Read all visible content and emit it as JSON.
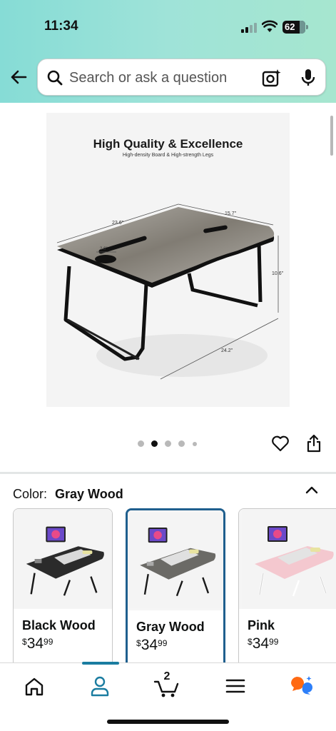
{
  "status_bar": {
    "time": "11:34",
    "battery": "62"
  },
  "search": {
    "placeholder": "Search or ask a question"
  },
  "product_image": {
    "title": "High Quality & Excellence",
    "subtitle": "High-density Board & High-strength Legs",
    "dimensions": [
      "23.6\"",
      "15.7\"",
      "2.6\"",
      "10.6\"",
      "24.2\""
    ]
  },
  "carousel": {
    "count": 5,
    "active_index": 1
  },
  "color_selector": {
    "label": "Color:",
    "selected": "Gray Wood",
    "options": [
      {
        "name": "Black Wood",
        "price_symbol": "$",
        "price_whole": "34",
        "price_fraction": "99",
        "tray_color": "#2b2b2b",
        "leg_color": "#1a1a1a"
      },
      {
        "name": "Gray Wood",
        "price_symbol": "$",
        "price_whole": "34",
        "price_fraction": "99",
        "tray_color": "#6b6a66",
        "leg_color": "#1a1a1a"
      },
      {
        "name": "Pink",
        "price_symbol": "$",
        "price_whole": "34",
        "price_fraction": "99",
        "tray_color": "#f4c8cf",
        "leg_color": "#ffffff"
      }
    ]
  },
  "bottom_nav": {
    "items": [
      "home-icon",
      "account-icon",
      "cart-icon",
      "menu-icon",
      "rufus-icon"
    ],
    "cart_count": "2",
    "active": "account-icon"
  },
  "colors": {
    "header_start": "#86dcd6",
    "header_end": "#a6e6cf",
    "selected_border": "#1f5f8e",
    "nav_accent": "#1a7ca0"
  }
}
